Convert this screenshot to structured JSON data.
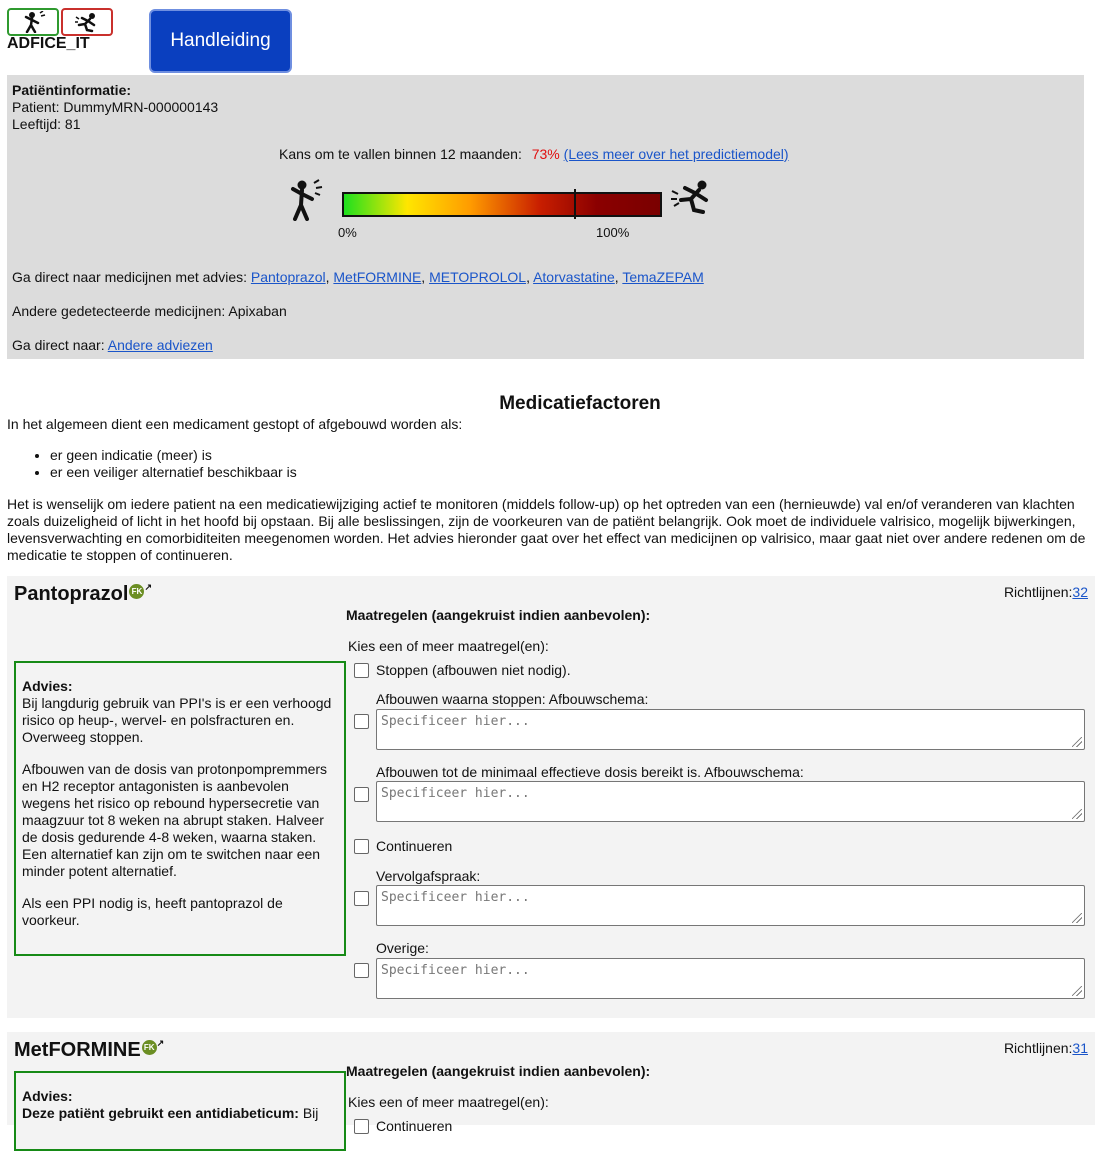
{
  "header": {
    "logo_text": "ADFICE_IT",
    "manual_label": "Handleiding"
  },
  "patient": {
    "title": "Patiëntinformatie:",
    "patient_line": "Patient: DummyMRN-000000143",
    "age_line": "Leeftijd: 81",
    "risk_label": "Kans om te vallen binnen 12 maanden:",
    "risk_value": "73%",
    "risk_fraction": 0.73,
    "risk_link": "(Lees meer over het predictiemodel)",
    "bar_min": "0%",
    "bar_max": "100%",
    "meds_label": "Ga direct naar medicijnen met advies:",
    "meds": [
      "Pantoprazol",
      "MetFORMINE",
      "METOPROLOL",
      "Atorvastatine",
      "TemaZEPAM"
    ],
    "other_meds": "Andere gedetecteerde medicijnen: Apixaban",
    "goto_label": "Ga direct naar:",
    "goto_link": "Andere adviezen"
  },
  "content": {
    "title": "Medicatiefactoren",
    "intro": "In het algemeen dient een medicament gestopt of afgebouwd worden als:",
    "bullets": [
      "er geen indicatie (meer) is",
      "er een veiliger alternatief beschikbaar is"
    ],
    "paragraph": "Het is wenselijk om iedere patient na een medicatiewijziging actief te monitoren (middels follow-up) op het optreden van een (hernieuwde) val en/of veranderen van klachten zoals duizeligheid of licht in het hoofd bij opstaan. Bij alle beslissingen, zijn de voorkeuren van de patiënt belangrijk. Ook moet de individuele valrisico, mogelijk bijwerkingen, levensverwachting en comorbiditeiten meegenomen worden. Het advies hieronder gaat over het effect van medicijnen op valrisico, maar gaat niet over andere redenen om de medicatie te stoppen of continueren."
  },
  "card1": {
    "name": "Pantoprazol",
    "fk": "FK",
    "guides_label": "Richtlijnen:",
    "guides_count": "32",
    "maat_title": "Maatregelen (aangekruist indien aanbevolen):",
    "kies": "Kies een of meer maatregel(en):",
    "advice_title": "Advies:",
    "advice_p1": "Bij langdurig gebruik van PPI's is er een verhoogd risico op heup-, wervel- en polsfracturen en. Overweeg stoppen.",
    "advice_p2": "Afbouwen van de dosis van protonpompremmers en H2 receptor antagonisten is aanbevolen wegens het risico op rebound hypersecretie van maagzuur tot 8 weken na abrupt staken. Halveer de dosis gedurende 4-8 weken, waarna staken. Een alternatief kan zijn om te switchen naar een minder potent alternatief.",
    "advice_p3": "Als een PPI nodig is, heeft pantoprazol de voorkeur.",
    "opt1": "Stoppen (afbouwen niet nodig).",
    "opt2": "Afbouwen waarna stoppen: Afbouwschema:",
    "opt3": "Afbouwen tot de minimaal effectieve dosis bereikt is. Afbouwschema:",
    "opt4": "Continueren",
    "opt5": "Vervolgafspraak:",
    "opt6": "Overige:",
    "placeholder": "Specificeer hier..."
  },
  "card2": {
    "name": "MetFORMINE",
    "fk": "FK",
    "guides_label": "Richtlijnen:",
    "guides_count": "31",
    "maat_title": "Maatregelen (aangekruist indien aanbevolen):",
    "kies": "Kies een of meer maatregel(en):",
    "advice_title": "Advies:",
    "advice_bold": "Deze patiënt gebruikt een antidiabeticum:",
    "advice_rest": " Bij",
    "opt1": "Continueren"
  }
}
